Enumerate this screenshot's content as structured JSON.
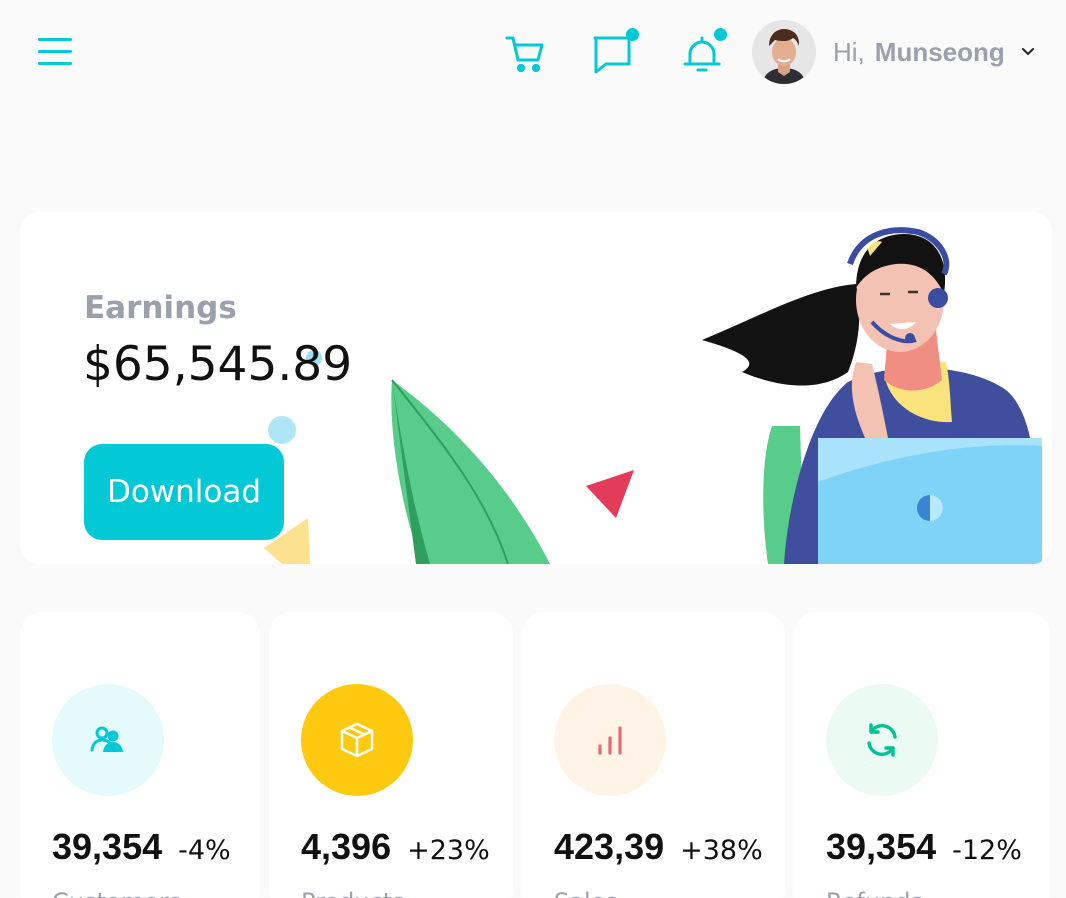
{
  "header": {
    "greeting": "Hi,",
    "user_name": "Munseong",
    "icons": [
      "menu-icon",
      "cart-icon",
      "chat-icon",
      "bell-icon",
      "chevron-down-icon"
    ],
    "accent_color": "#03c9d7"
  },
  "earnings": {
    "label": "Earnings",
    "value": "$65,545.89",
    "download_label": "Download"
  },
  "stats": [
    {
      "value": "39,354",
      "change": "-4%",
      "title": "Customers",
      "icon": "users-icon",
      "icon_color": "#03c9d7",
      "icon_bg": "#e5fafb"
    },
    {
      "value": "4,396",
      "change": "+23%",
      "title": "Products",
      "icon": "box-icon",
      "icon_color": "#ffffff",
      "icon_bg": "#fec90f"
    },
    {
      "value": "423,39",
      "change": "+38%",
      "title": "Sales",
      "icon": "bar-chart-icon",
      "icon_color": "#e46a76",
      "icon_bg": "#fff4e5"
    },
    {
      "value": "39,354",
      "change": "-12%",
      "title": "Refunds",
      "icon": "refresh-icon",
      "icon_color": "#00c292",
      "icon_bg": "#ebfaf2"
    }
  ]
}
